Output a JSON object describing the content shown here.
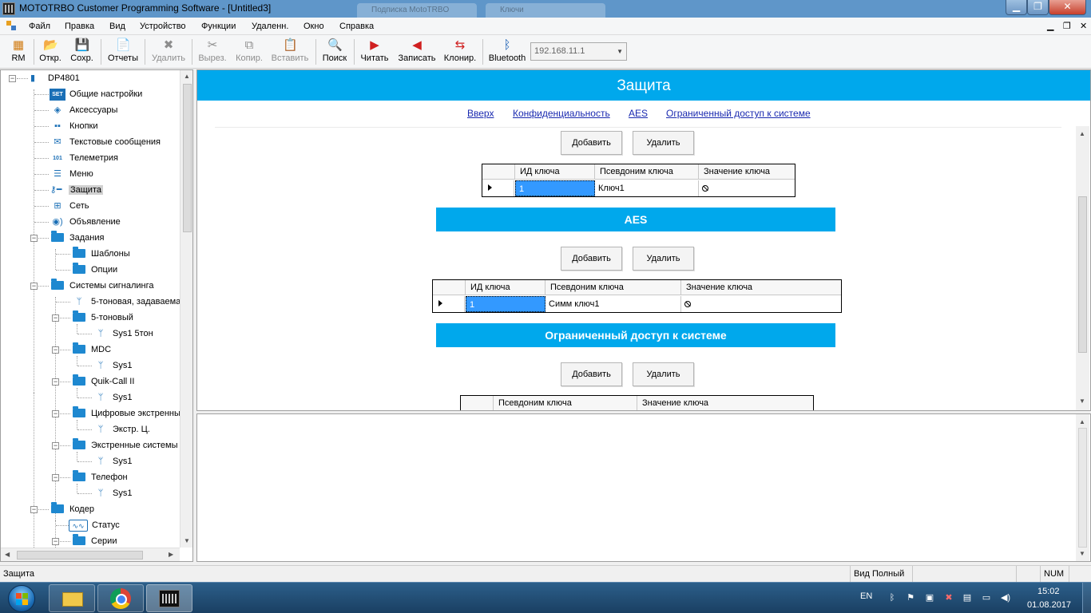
{
  "window": {
    "title": "MOTOTRBO Customer Programming Software - [Untitled3]",
    "bg_tabs": [
      "Подписка MotoTRBO",
      "Ключи"
    ]
  },
  "menu": {
    "items": [
      "Файл",
      "Правка",
      "Вид",
      "Устройство",
      "Функции",
      "Удаленн.",
      "Окно",
      "Справка"
    ]
  },
  "toolbar": {
    "rm": "RM",
    "open": "Откр.",
    "save": "Сохр.",
    "reports": "Отчеты",
    "delete": "Удалить",
    "cut": "Вырез.",
    "copy": "Копир.",
    "paste": "Вставить",
    "search": "Поиск",
    "read": "Читать",
    "write": "Записать",
    "clone": "Клонир.",
    "bluetooth": "Bluetooth",
    "ip_address": "192.168.11.1"
  },
  "tree": {
    "root": "DP4801",
    "items": {
      "general": "Общие настройки",
      "accessories": "Аксессуары",
      "buttons": "Кнопки",
      "text_messages": "Текстовые сообщения",
      "telemetry": "Телеметрия",
      "menu": "Меню",
      "security": "Защита",
      "network": "Сеть",
      "announcement": "Объявление",
      "jobs": "Задания",
      "templates": "Шаблоны",
      "options": "Опции",
      "signaling": "Системы сигналинга",
      "five_tone_def": "5-тоновая, задаваема",
      "five_tone": "5-тоновый",
      "sys1_5tone": "Sys1 5тон",
      "mdc": "MDC",
      "sys1_mdc": "Sys1",
      "quikcall": "Quik-Call II",
      "sys1_qc": "Sys1",
      "digital_emergency": "Цифровые экстренны",
      "emerg_c": "Экстр. Ц.",
      "emergency_systems": "Экстренные системы",
      "sys1_emerg": "Sys1",
      "phone": "Телефон",
      "sys1_phone": "Sys1",
      "coder": "Кодер",
      "status": "Статус",
      "series": "Серии"
    }
  },
  "content": {
    "title": "Защита",
    "nav_links": [
      "Вверх",
      "Конфиденциальность",
      "AES",
      "Ограниченный доступ к системе"
    ],
    "add_label": "Добавить",
    "remove_label": "Удалить",
    "privacy_table": {
      "headers": [
        "ИД ключа",
        "Псевдоним ключа",
        "Значение ключа"
      ],
      "row": {
        "id": "1",
        "alias": "Ключ1"
      }
    },
    "aes_section": {
      "title": "AES",
      "headers": [
        "ИД ключа",
        "Псевдоним ключа",
        "Значение ключа"
      ],
      "row": {
        "id": "1",
        "alias": "Симм ключ1"
      }
    },
    "restricted_section": {
      "title": "Ограниченный доступ к системе",
      "headers": [
        "Псевдоним ключа",
        "Значение ключа"
      ]
    }
  },
  "statusbar": {
    "left": "Защита",
    "view": "Вид Полный",
    "num": "NUM"
  },
  "taskbar": {
    "lang": "EN",
    "time": "15:02",
    "date": "01.08.2017"
  }
}
